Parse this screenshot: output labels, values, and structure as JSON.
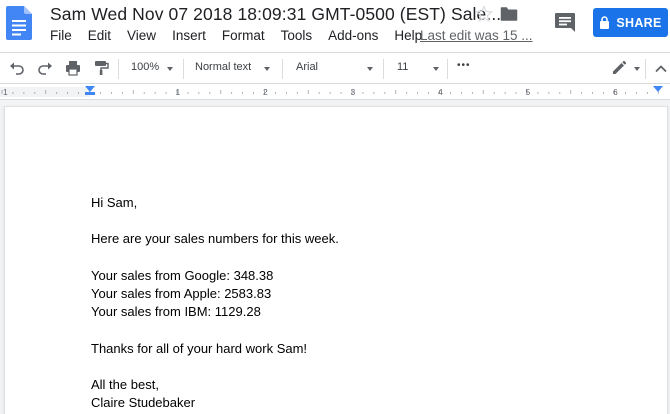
{
  "header": {
    "title": "Sam Wed Nov 07 2018 18:09:31 GMT-0500 (EST) Sale...",
    "share_label": "SHARE",
    "last_edit": "Last edit was 15 ..."
  },
  "menu": [
    "File",
    "Edit",
    "View",
    "Insert",
    "Format",
    "Tools",
    "Add-ons",
    "Help"
  ],
  "toolbar": {
    "zoom": "100%",
    "style": "Normal text",
    "font": "Arial",
    "size": "11",
    "more": "•••"
  },
  "ruler": {
    "numbers": [
      "1",
      "1",
      "2",
      "3",
      "4",
      "5",
      "6"
    ]
  },
  "document": {
    "lines": [
      "Hi Sam,",
      "Here are your sales numbers for this week.",
      "Your sales from Google: 348.38",
      "Your sales from Apple: 2583.83",
      "Your sales from IBM: 1129.28",
      "Thanks for all of your hard work Sam!",
      "All the best,",
      "Claire Studebaker"
    ]
  },
  "colors": {
    "accent": "#1a73e8",
    "doc_icon": "#4285f4"
  }
}
